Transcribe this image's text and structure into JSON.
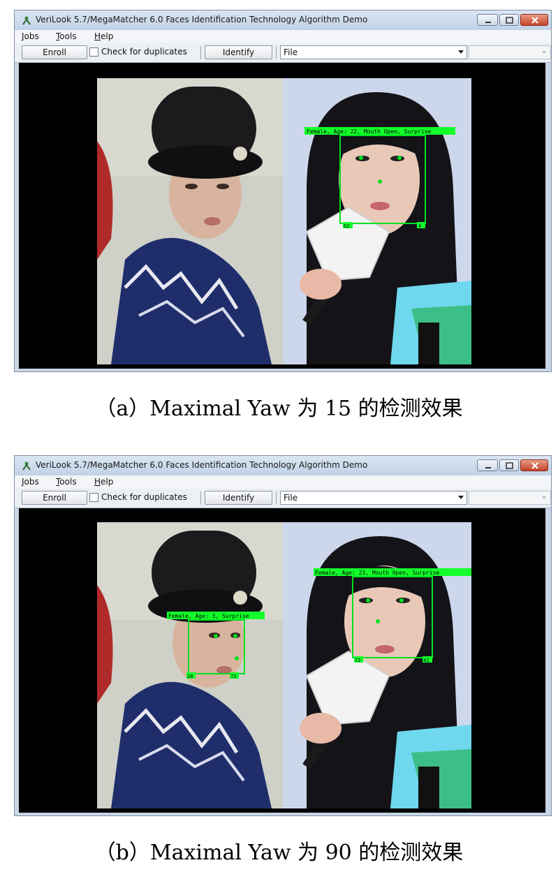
{
  "colors": {
    "detection_box": "#00e020",
    "label_bg": "#12ff2a",
    "viewer_bg": "#000000",
    "titlebar": "#c9d6e6"
  },
  "panels": [
    {
      "id": "a",
      "window_title": "VeriLook 5.7/MegaMatcher 6.0 Faces Identification Technology Algorithm Demo",
      "menu": [
        {
          "underline": "J",
          "rest": "obs"
        },
        {
          "underline": "T",
          "rest": "ools"
        },
        {
          "underline": "H",
          "rest": "elp"
        }
      ],
      "toolbar": {
        "enroll_label": "Enroll",
        "check_duplicates_label": "Check for duplicates",
        "check_duplicates_checked": false,
        "identify_label": "Identify",
        "source_selected": "File"
      },
      "detections": [
        {
          "label": "Female, Age: 22, Mouth Open, Surprise",
          "corner_left": "62",
          "corner_right": "4"
        }
      ],
      "caption": "（a）Maximal Yaw 为 15 的检测效果"
    },
    {
      "id": "b",
      "window_title": "VeriLook 5.7/MegaMatcher 6.0 Faces Identification Technology Algorithm Demo",
      "menu": [
        {
          "underline": "J",
          "rest": "obs"
        },
        {
          "underline": "T",
          "rest": "ools"
        },
        {
          "underline": "H",
          "rest": "elp"
        }
      ],
      "toolbar": {
        "enroll_label": "Enroll",
        "check_duplicates_label": "Check for duplicates",
        "check_duplicates_checked": false,
        "identify_label": "Identify",
        "source_selected": "File"
      },
      "detections": [
        {
          "label": "Female, Age: 3, Surprise",
          "corner_left": "20",
          "corner_right": "72"
        },
        {
          "label": "Female, Age: 23, Mouth Open, Surprise",
          "corner_left": "72",
          "corner_right": "42"
        }
      ],
      "caption": "（b）Maximal Yaw 为 90 的检测效果"
    }
  ]
}
